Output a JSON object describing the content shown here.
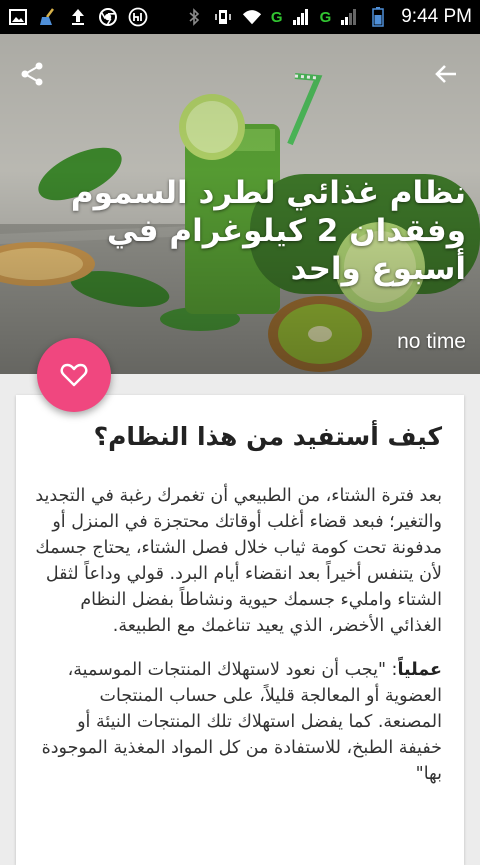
{
  "status_bar": {
    "time": "9:44 PM",
    "network_label_1": "G",
    "network_label_2": "G"
  },
  "colors": {
    "accent": "#f0477f",
    "status_bar": "#000000",
    "network": "#31c431"
  },
  "header": {
    "share_icon": "share-icon",
    "back_icon": "arrow-back-icon"
  },
  "recipe": {
    "title": "نظام غذائي لطرد السموم وفقدان 2 كيلوغرام في أسبوع واحد",
    "time": "no time",
    "favorite_icon": "heart-outline-icon"
  },
  "content": {
    "heading": "كيف أستفيد من هذا النظام؟",
    "paragraph_1": "بعد فترة الشتاء، من الطبيعي أن تغمرك رغبة في التجديد والتغير؛ فبعد قضاء أغلب أوقاتك محتجزة في المنزل أو مدفونة تحت كومة ثياب خلال فصل الشتاء، يحتاج جسمك لأن يتنفس أخيراً بعد انقضاء أيام البرد. قولي وداعاً لثقل الشتاء وامليء جسمك حيوية ونشاطاً بفضل النظام الغذائي الأخضر، الذي يعيد تناغمك مع الطبيعة.",
    "paragraph_2_lead": "عملياً",
    "paragraph_2": ": \"يجب أن نعود لاستهلاك المنتجات الموسمية، العضوية أو المعالجة قليلاً، على حساب المنتجات المصنعة. كما يفضل استهلاك تلك المنتجات النيئة أو خفيفة الطبخ، للاستفادة من كل المواد المغذية الموجودة بها\""
  }
}
